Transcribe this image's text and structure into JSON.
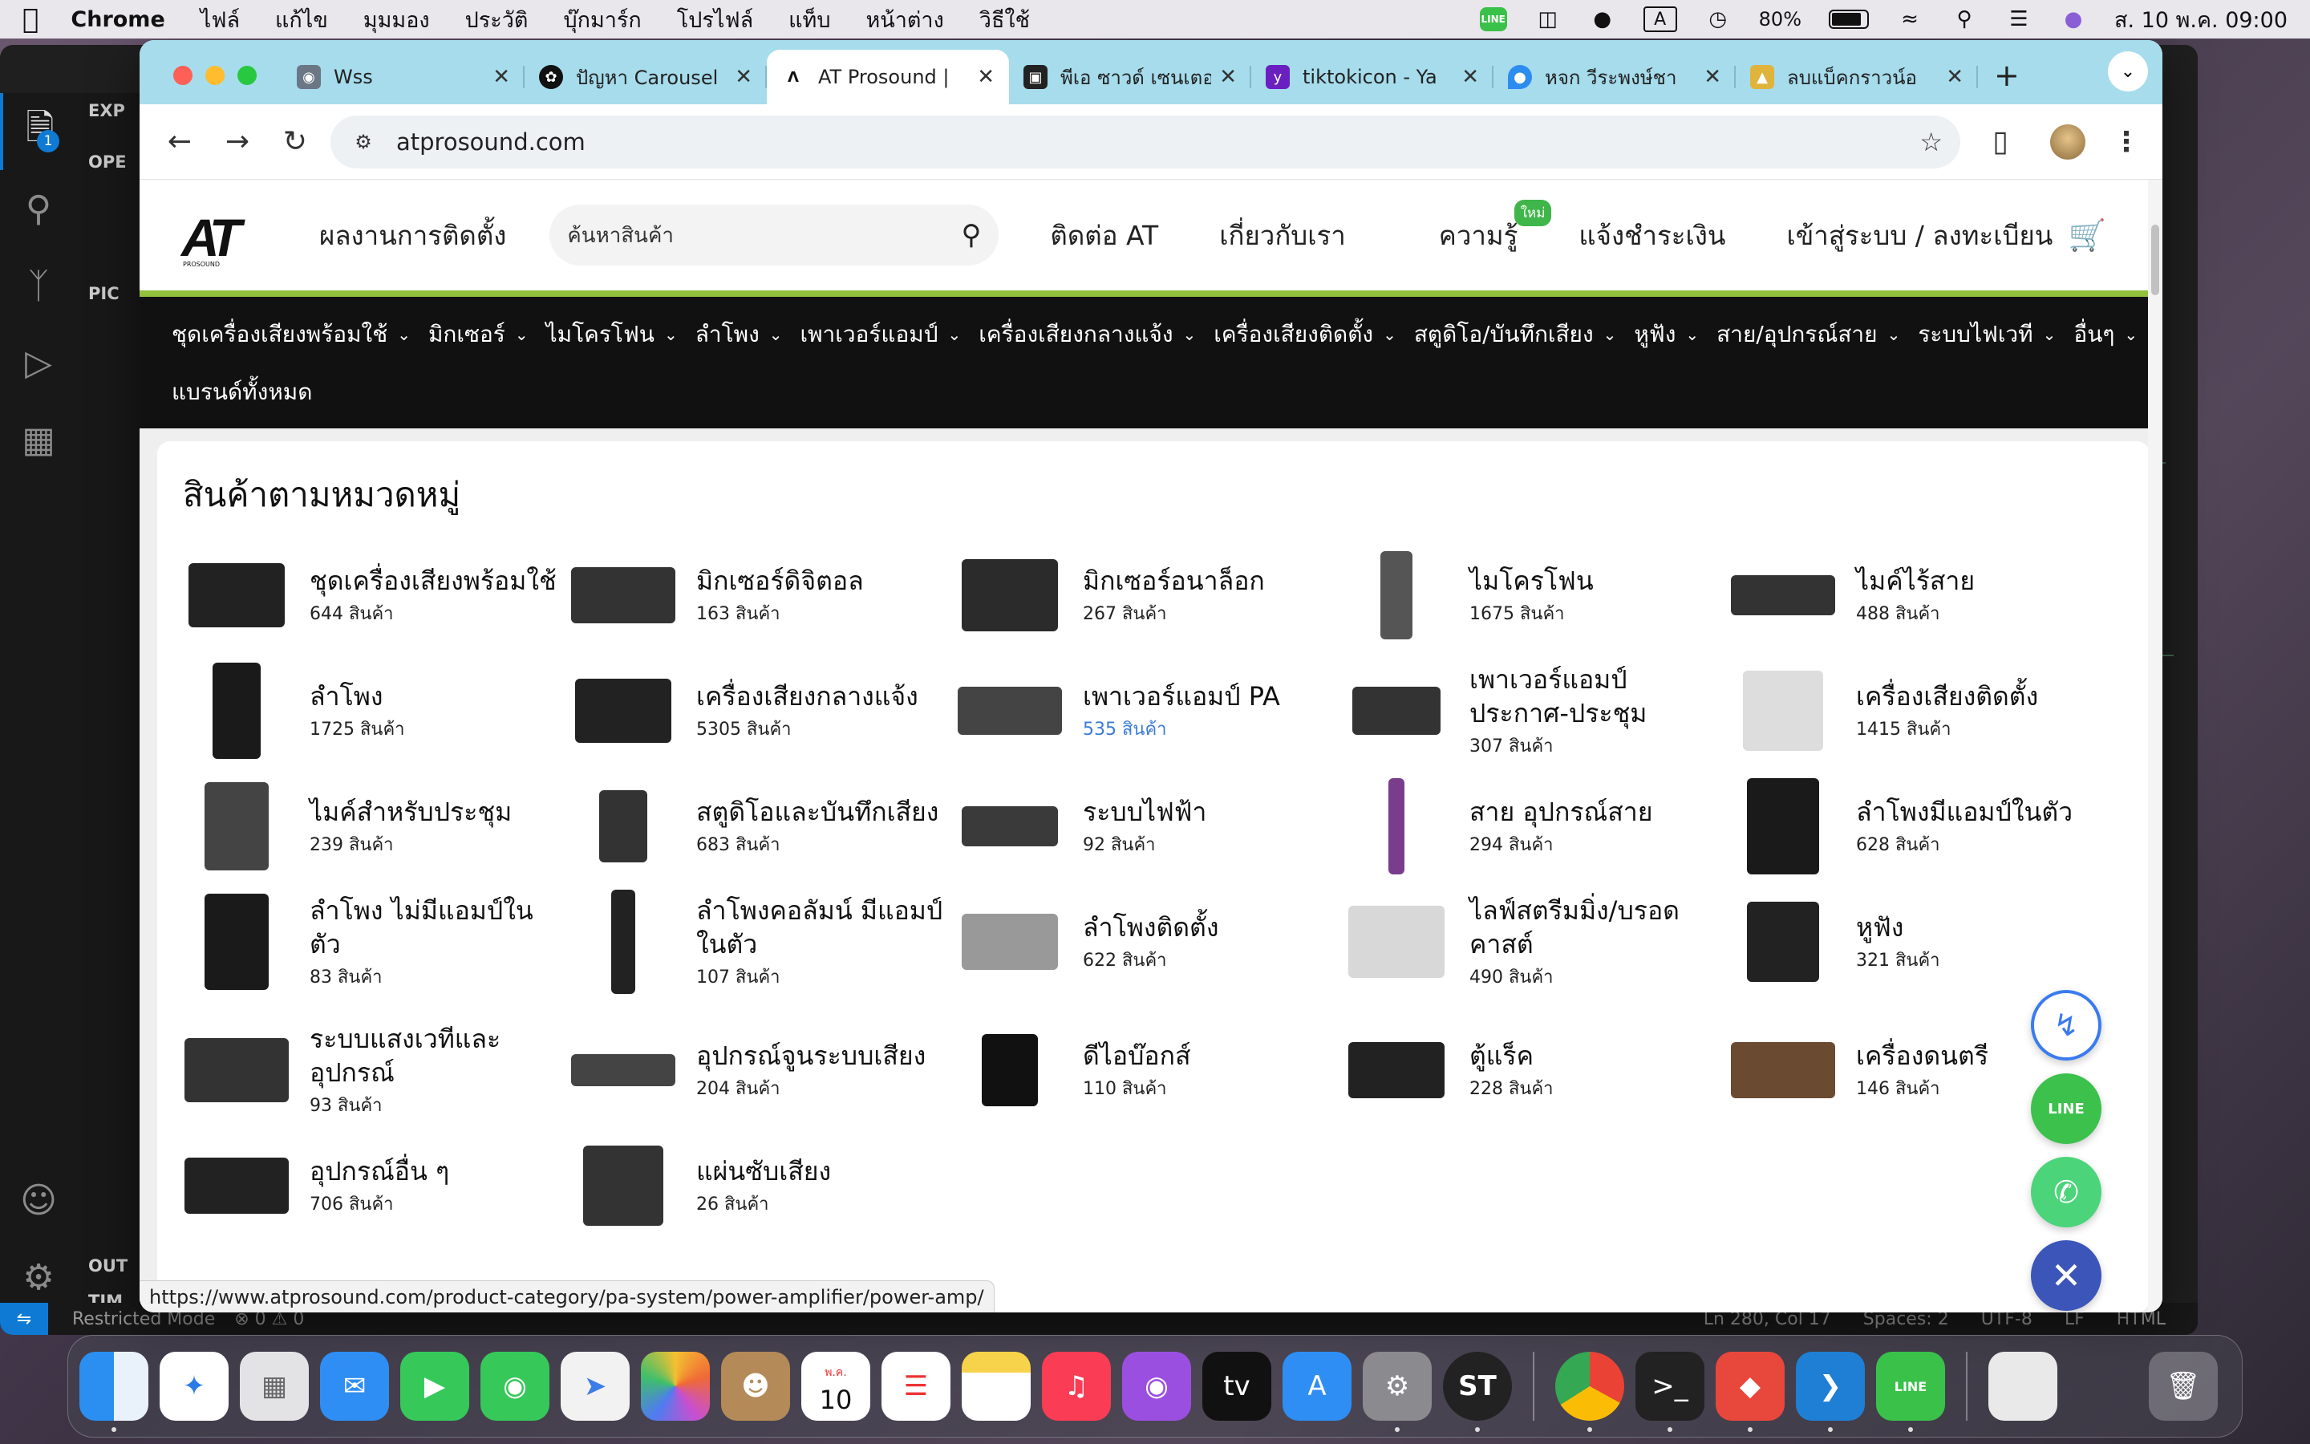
{
  "menubar": {
    "app": "Chrome",
    "items": [
      "ไฟล์",
      "แก้ไข",
      "มุมมอง",
      "ประวัติ",
      "บุ๊กมาร์ก",
      "โปรไฟล์",
      "แท็บ",
      "หน้าต่าง",
      "วิธีใช้"
    ],
    "input_indicator": "A",
    "battery": "80%",
    "datetime": "ส. 10 พ.ค. 09:00",
    "line_label": "LINE"
  },
  "vscode": {
    "explorer_badge": "1",
    "sections": [
      "EXP",
      "OPE",
      "PIC",
      "OUT",
      "TIM"
    ],
    "status_left": "Restricted Mode",
    "status_problems": "⊗ 0 ⚠ 0",
    "status_right": [
      "Ln 280, Col 17",
      "Spaces: 2",
      "UTF-8",
      "LF",
      "HTML"
    ]
  },
  "chrome": {
    "tabs": [
      {
        "title": "Wss",
        "active": false
      },
      {
        "title": "ปัญหา Carousel",
        "active": false
      },
      {
        "title": "AT Prosound |",
        "active": true
      },
      {
        "title": "พีเอ ซาวด์ เซนเตอร์",
        "active": false
      },
      {
        "title": "tiktokicon - Ya",
        "active": false
      },
      {
        "title": "หจก วีระพงษ์ชา",
        "active": false
      },
      {
        "title": "ลบแบ็คกราวน์อ",
        "active": false
      }
    ],
    "url": "atprosound.com",
    "status_url": "https://www.atprosound.com/product-category/pa-system/power-amplifier/power-amp/"
  },
  "site": {
    "logo_text": "AT",
    "logo_sub": "PROSOUND",
    "header_links": {
      "portfolio": "ผลงานการติดตั้ง",
      "contact": "ติดต่อ AT",
      "about": "เกี่ยวกับเรา",
      "knowledge": "ความรู้",
      "knowledge_badge": "ใหม่",
      "payment": "แจ้งชำระเงิน",
      "login": "เข้าสู่ระบบ / ลงทะเบียน"
    },
    "search_placeholder": "ค้นหาสินค้า",
    "catnav": [
      "ชุดเครื่องเสียงพร้อมใช้",
      "มิกเซอร์",
      "ไมโครโฟน",
      "ลำโพง",
      "เพาเวอร์แอมป์",
      "เครื่องเสียงกลางแจ้ง",
      "เครื่องเสียงติดตั้ง",
      "สตูดิโอ/บันทึกเสียง",
      "หูฟัง",
      "สาย/อุปกรณ์สาย",
      "ระบบไฟเวที",
      "อื่นๆ"
    ],
    "all_brands": "แบรนด์ทั้งหมด",
    "section_title": "สินค้าตามหมวดหมู่",
    "categories": [
      {
        "name": "ชุดเครื่องเสียงพร้อมใช้",
        "count": "644 สินค้า"
      },
      {
        "name": "มิกเซอร์ดิจิตอล",
        "count": "163 สินค้า"
      },
      {
        "name": "มิกเซอร์อนาล็อก",
        "count": "267 สินค้า"
      },
      {
        "name": "ไมโครโฟน",
        "count": "1675 สินค้า"
      },
      {
        "name": "ไมค์ไร้สาย",
        "count": "488 สินค้า"
      },
      {
        "name": "ลำโพง",
        "count": "1725 สินค้า"
      },
      {
        "name": "เครื่องเสียงกลางแจ้ง",
        "count": "5305 สินค้า"
      },
      {
        "name": "เพาเวอร์แอมป์ PA",
        "count": "535 สินค้า"
      },
      {
        "name": "เพาเวอร์แอมป์ประกาศ-ประชุม",
        "count": "307 สินค้า"
      },
      {
        "name": "เครื่องเสียงติดตั้ง",
        "count": "1415 สินค้า"
      },
      {
        "name": "ไมค์สำหรับประชุม",
        "count": "239 สินค้า"
      },
      {
        "name": "สตูดิโอและบันทึกเสียง",
        "count": "683 สินค้า"
      },
      {
        "name": "ระบบไฟฟ้า",
        "count": "92 สินค้า"
      },
      {
        "name": "สาย อุปกรณ์สาย",
        "count": "294 สินค้า"
      },
      {
        "name": "ลำโพงมีแอมป์ในตัว",
        "count": "628 สินค้า"
      },
      {
        "name": "ลำโพง ไม่มีแอมป์ในตัว",
        "count": "83 สินค้า"
      },
      {
        "name": "ลำโพงคอลัมน์ มีแอมป์ในตัว",
        "count": "107 สินค้า"
      },
      {
        "name": "ลำโพงติดตั้ง",
        "count": "622 สินค้า"
      },
      {
        "name": "ไลฟ์สตรีมมิ่ง/บรอดคาสต์",
        "count": "490 สินค้า"
      },
      {
        "name": "หูฟัง",
        "count": "321 สินค้า"
      },
      {
        "name": "ระบบแสงเวทีและอุปกรณ์",
        "count": "93 สินค้า"
      },
      {
        "name": "อุปกรณ์จูนระบบเสียง",
        "count": "204 สินค้า"
      },
      {
        "name": "ดีไอบ๊อกส์",
        "count": "110 สินค้า"
      },
      {
        "name": "ตู้แร็ค",
        "count": "228 สินค้า"
      },
      {
        "name": "เครื่องดนตรี",
        "count": "146 สินค้า"
      },
      {
        "name": "อุปกรณ์อื่น ๆ",
        "count": "706 สินค้า"
      },
      {
        "name": "แผ่นซับเสียง",
        "count": "26 สินค้า"
      }
    ],
    "fab_line_label": "LINE"
  },
  "dock": {
    "calendar_month": "พ.ค.",
    "calendar_day": "10"
  }
}
